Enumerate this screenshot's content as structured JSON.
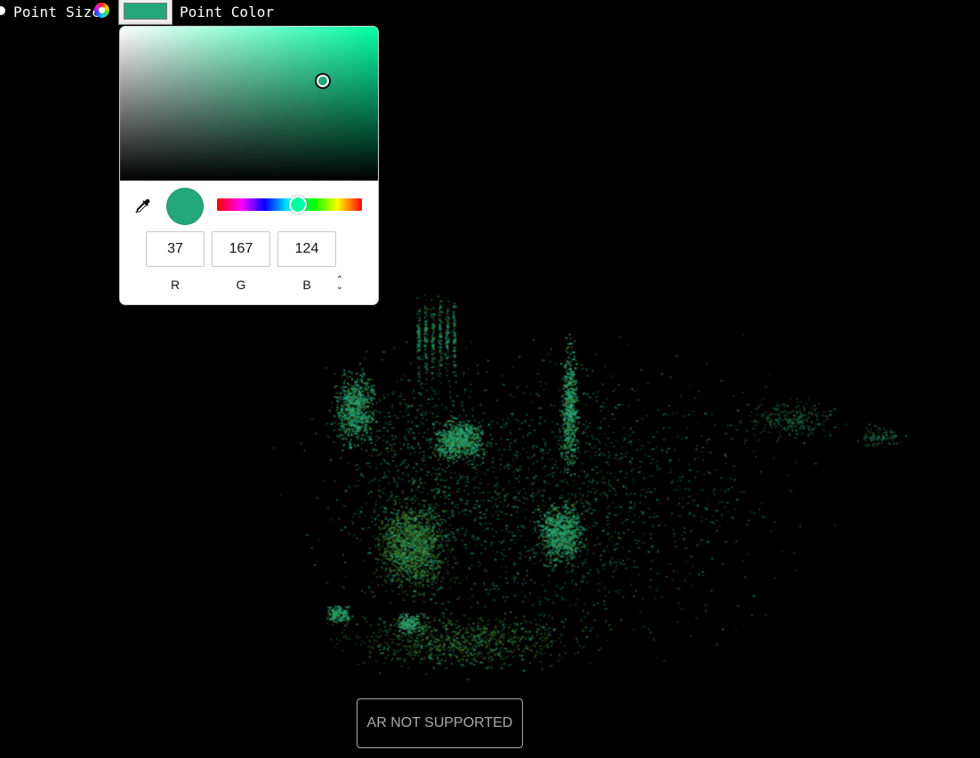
{
  "toolbar": {
    "point_size_label": "Point Size",
    "point_color_label": "Point Color",
    "color_wheel_icon": "color-wheel-icon",
    "swatch_color": "#25a77c"
  },
  "color_picker": {
    "current_color": "#25a77c",
    "pure_hue_color": "#00ffa5",
    "hue_degrees": 159,
    "saturation": 0.78,
    "value": 0.65,
    "rgb": {
      "r": "37",
      "g": "167",
      "b": "124"
    },
    "channel_labels": {
      "r": "R",
      "g": "G",
      "b": "B"
    },
    "eyedropper_icon": "eyedropper-icon",
    "mode_toggle_icon": "chevron-up-down-icon"
  },
  "viewer": {
    "point_color": "#25a77c",
    "secondary_point_color": "#3e7a2a",
    "background": "#000000"
  },
  "ar_button": {
    "label": "AR NOT SUPPORTED"
  }
}
